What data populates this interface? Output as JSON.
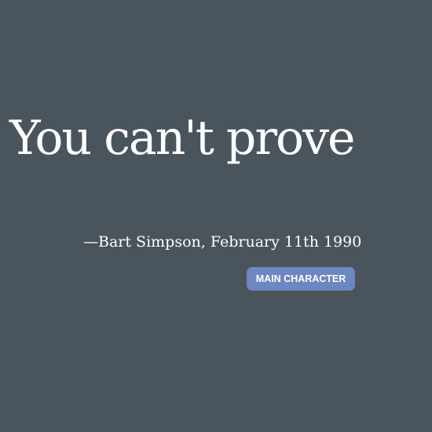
{
  "quote": {
    "text": "You can't prove",
    "attribution": "—Bart Simpson, February 11th 1990"
  },
  "badge": {
    "label": "MAIN CHARACTER"
  },
  "colors": {
    "background": "#4a545c",
    "text": "#ffffff",
    "badge_background": "#6c87c1"
  }
}
